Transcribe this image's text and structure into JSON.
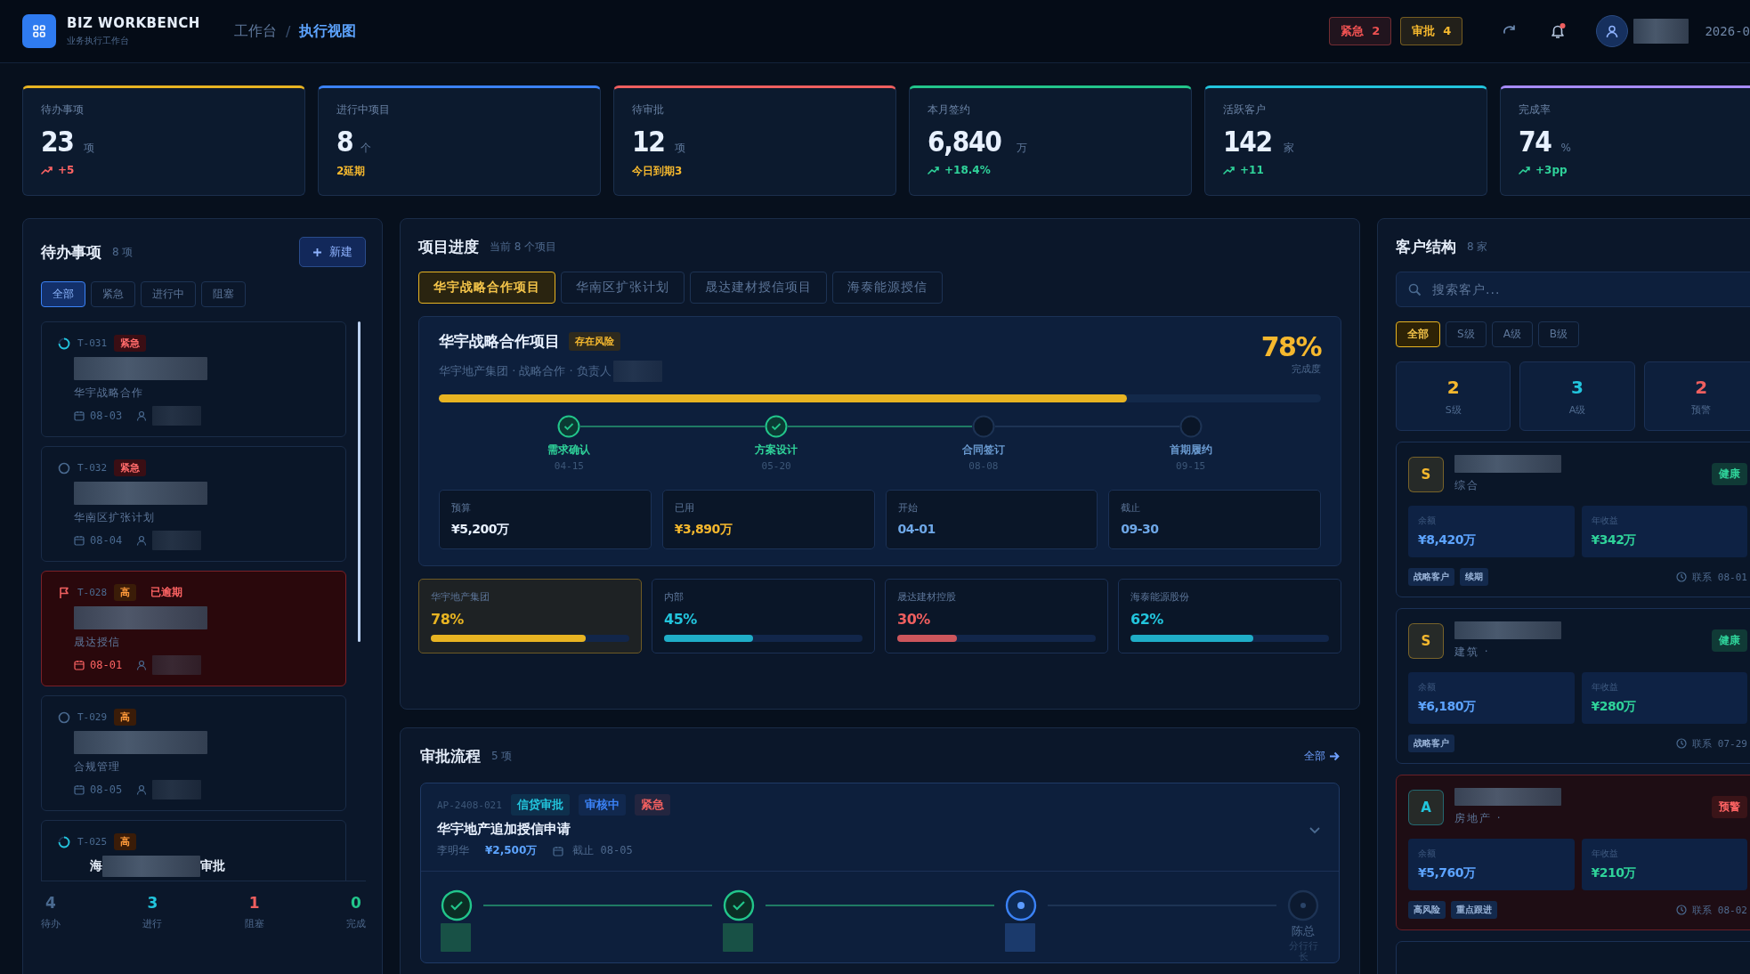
{
  "header": {
    "brand": "BIZ WORKBENCH",
    "subtitle": "业务执行工作台",
    "separator": "/",
    "breadcrumb": [
      {
        "label": "工作台",
        "selected": false
      },
      {
        "label": "执行视图",
        "selected": true
      }
    ],
    "badges": [
      {
        "label": "紧急",
        "count": "2",
        "color": "#f05252"
      },
      {
        "label": "审批",
        "count": "4",
        "color": "#f5b82e"
      }
    ],
    "notification_dot": true,
    "date": "2026-0"
  },
  "kpis": [
    {
      "label": "待办事项",
      "value": "23",
      "unit": "项",
      "note": "+5",
      "kind": "trend_bad",
      "color": "#e8b422"
    },
    {
      "label": "进行中项目",
      "value": "8",
      "unit": "个",
      "note": "2延期",
      "kind": "warning",
      "color": "#3b82f6"
    },
    {
      "label": "待审批",
      "value": "12",
      "unit": "项",
      "note": "今日到期3",
      "kind": "warning",
      "color": "#ef5f5f"
    },
    {
      "label": "本月签约",
      "value": "6,840",
      "unit": "万",
      "note": "+18.4%",
      "kind": "trend_good",
      "color": "#22c58b"
    },
    {
      "label": "活跃客户",
      "value": "142",
      "unit": "家",
      "note": "+11",
      "kind": "trend_good",
      "color": "#22c5dd"
    },
    {
      "label": "完成率",
      "value": "74",
      "unit": "%",
      "note": "+3pp",
      "kind": "trend_good",
      "color": "#a78bfa"
    }
  ],
  "todo": {
    "title": "待办事项",
    "count": "8 项",
    "new_button": "新建",
    "filters": [
      {
        "label": "全部",
        "selected": true
      },
      {
        "label": "紧急",
        "selected": false
      },
      {
        "label": "进行中",
        "selected": false
      },
      {
        "label": "阻塞",
        "selected": false
      }
    ],
    "items": [
      {
        "id": "T-031",
        "kind": "in_progress",
        "urgent": true,
        "priority_label": "紧急",
        "project": "华宇战略合作",
        "date": "08-03",
        "overdue": false
      },
      {
        "id": "T-032",
        "kind": "todo",
        "urgent": true,
        "priority_label": "紧急",
        "project": "华南区扩张计划",
        "date": "08-04",
        "overdue": false
      },
      {
        "id": "T-028",
        "kind": "flagged",
        "urgent": false,
        "priority_label": "高",
        "overdue_label": "已逾期",
        "project": "晟达授信",
        "date": "08-01",
        "overdue": true
      },
      {
        "id": "T-029",
        "kind": "todo",
        "urgent": false,
        "priority_label": "高",
        "project": "合规管理",
        "date": "08-05",
        "overdue": false
      },
      {
        "id": "T-025",
        "kind": "in_progress",
        "urgent": false,
        "priority_label": "高",
        "title_start": "海",
        "title_end": "审批",
        "overdue": false
      }
    ],
    "summary": [
      {
        "value": "4",
        "label": "待办",
        "color": "#4a6a90"
      },
      {
        "value": "3",
        "label": "进行",
        "color": "#22c5dd"
      },
      {
        "value": "1",
        "label": "阻塞",
        "color": "#ef5f5f"
      },
      {
        "value": "0",
        "label": "完成",
        "color": "#22c58b"
      }
    ]
  },
  "projects": {
    "title": "项目进度",
    "subtitle": "当前 8 个项目",
    "tabs": [
      {
        "label": "华宇战略合作项目",
        "selected": true
      },
      {
        "label": "华南区扩张计划",
        "selected": false
      },
      {
        "label": "晟达建材授信项目",
        "selected": false
      },
      {
        "label": "海泰能源授信",
        "selected": false
      }
    ],
    "detail": {
      "name": "华宇战略合作项目",
      "risk": "存在风险",
      "meta": "华宇地产集团 · 战略合作 · 负责人",
      "percent": "78%",
      "percent_label": "完成度",
      "level": 0.78,
      "milestones": [
        {
          "label": "需求确认",
          "date": "04-15",
          "done": true
        },
        {
          "label": "方案设计",
          "date": "05-20",
          "done": true
        },
        {
          "label": "合同签订",
          "date": "08-08",
          "done": false
        },
        {
          "label": "首期履约",
          "date": "09-15",
          "done": false
        }
      ],
      "stats": [
        {
          "label": "预算",
          "value": "¥5,200万",
          "color": "#e8f1ff"
        },
        {
          "label": "已用",
          "value": "¥3,890万",
          "color": "#f5b82e"
        },
        {
          "label": "开始",
          "value": "04-01",
          "color": "#6fa8e8"
        },
        {
          "label": "截止",
          "value": "09-30",
          "color": "#6fa8e8"
        }
      ]
    },
    "clients": [
      {
        "name": "华宇地产集团",
        "percent": "78%",
        "level": 0.78,
        "color": "#e8b422",
        "selected": true
      },
      {
        "name": "内部",
        "percent": "45%",
        "level": 0.45,
        "color": "#22c5dd",
        "selected": false
      },
      {
        "name": "晟达建材控股",
        "percent": "30%",
        "level": 0.3,
        "color": "#ef5f5f",
        "selected": false
      },
      {
        "name": "海泰能源股份",
        "percent": "62%",
        "level": 0.62,
        "color": "#22c5dd",
        "selected": false
      }
    ]
  },
  "approvals": {
    "title": "审批流程",
    "count": "5 项",
    "link": "全部",
    "items": [
      {
        "id": "AP-2408-021",
        "tags": [
          {
            "label": "信贷审批",
            "color": "#22c5dd"
          },
          {
            "label": "审核中",
            "color": "#3b82f6"
          },
          {
            "label": "紧急",
            "color": "#ef5f5f"
          }
        ],
        "title": "华宇地产追加授信申请",
        "applicant": "李明华",
        "amount": "¥2,500万",
        "deadline": "截止 08-05",
        "expanded": true,
        "steps": [
          {
            "kind": "done"
          },
          {
            "kind": "done"
          },
          {
            "kind": "current"
          },
          {
            "kind": "pending",
            "name": "陈总",
            "role": "分行行长"
          }
        ]
      }
    ]
  },
  "customers": {
    "title": "客户结构",
    "count": "8 家",
    "search_placeholder": "搜索客户...",
    "filters": [
      {
        "label": "全部",
        "selected": true
      },
      {
        "label": "S级",
        "selected": false
      },
      {
        "label": "A级",
        "selected": false
      },
      {
        "label": "B级",
        "selected": false
      }
    ],
    "stats": [
      {
        "value": "2",
        "label": "S级",
        "color": "#f5b82e"
      },
      {
        "value": "3",
        "label": "A级",
        "color": "#22c5dd"
      },
      {
        "value": "2",
        "label": "预警",
        "color": "#ef5f5f"
      }
    ],
    "items": [
      {
        "grade": "S",
        "category": "综合",
        "status": "健康",
        "alert": false,
        "balance_label": "余额",
        "balance": "¥8,420万",
        "revenue_label": "年收益",
        "revenue": "¥342万",
        "tags": [
          "战略客户",
          "续期"
        ],
        "contact": "联系 08-01"
      },
      {
        "grade": "S",
        "category": "建筑 ·",
        "status": "健康",
        "alert": false,
        "balance_label": "余额",
        "balance": "¥6,180万",
        "revenue_label": "年收益",
        "revenue": "¥280万",
        "tags": [
          "战略客户"
        ],
        "contact": "联系 07-29"
      },
      {
        "grade": "A",
        "category": "房地产 ·",
        "status": "预警",
        "alert": true,
        "balance_label": "余额",
        "balance": "¥5,760万",
        "revenue_label": "年收益",
        "revenue": "¥210万",
        "tags": [
          "高风险",
          "重点跟进"
        ],
        "contact": "联系 08-02"
      }
    ]
  }
}
